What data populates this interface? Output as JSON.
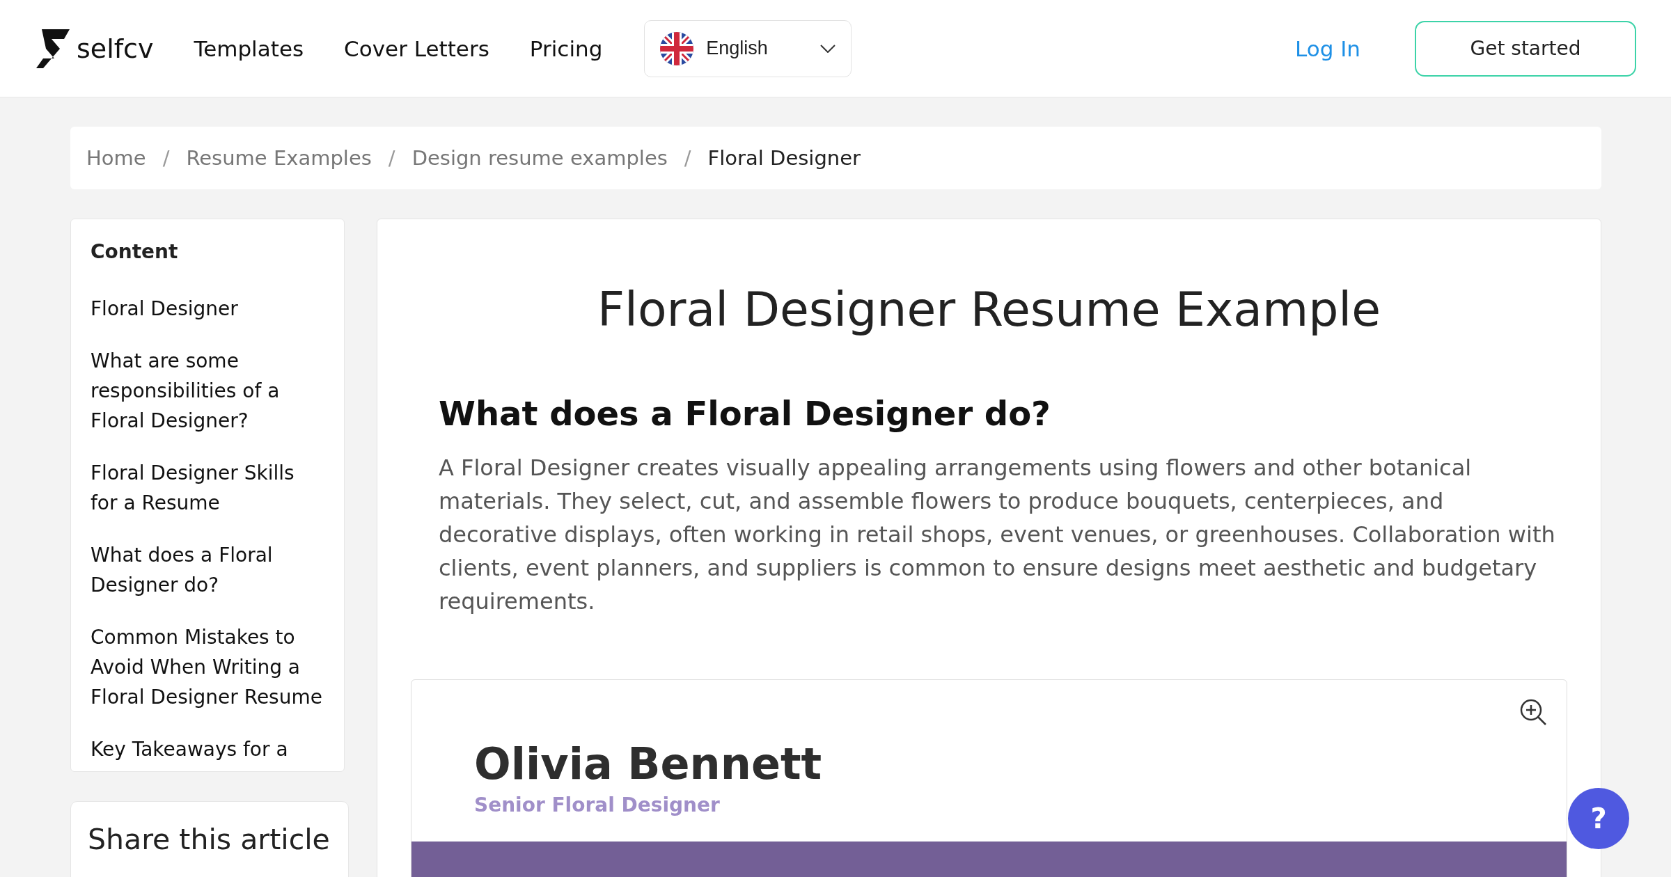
{
  "header": {
    "logo": "selfcv",
    "nav": [
      "Templates",
      "Cover Letters",
      "Pricing"
    ],
    "language": "English",
    "login": "Log In",
    "cta": "Get started"
  },
  "breadcrumb": [
    {
      "label": "Home"
    },
    {
      "separator": "/",
      "label": "Resume Examples"
    },
    {
      "separator": "/",
      "label": "Design resume examples"
    },
    {
      "separator": "/",
      "label": "Floral Designer"
    }
  ],
  "sidebar": {
    "title": "Content",
    "items": [
      "Floral Designer",
      "What are some responsibilities of a Floral Designer?",
      "Floral Designer Skills for a Resume",
      "What does a Floral Designer do?",
      "Common Mistakes to Avoid When Writing a Floral Designer Resume",
      "Key Takeaways for a"
    ]
  },
  "share": {
    "title": "Share this article"
  },
  "article": {
    "title": "Floral Designer Resume Example",
    "heading": "What does a Floral Designer do?",
    "paragraph": "A Floral Designer creates visually appealing arrangements using flowers and other botanical materials. They select, cut, and assemble flowers to produce bouquets, centerpieces, and decorative displays, often working in retail shops, event venues, or greenhouses. Collaboration with clients, event planners, and suppliers is common to ensure designs meet aesthetic and budgetary requirements."
  },
  "resume": {
    "name": "Olivia Bennett",
    "role": "Senior Floral Designer"
  },
  "help": "?"
}
